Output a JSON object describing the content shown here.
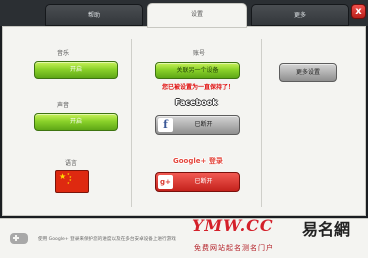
{
  "tabs": [
    {
      "label": "帮助"
    },
    {
      "label": "设置"
    },
    {
      "label": "更多"
    }
  ],
  "close_label": "x",
  "left_column": {
    "music_label": "音乐",
    "music_button": "开启",
    "sound_label": "声音",
    "sound_button": "开启",
    "language_label": "语言"
  },
  "middle_column": {
    "account_label": "账号",
    "account_button": "关联另一个设备",
    "warning_text": "您已被设置为一直保持了！",
    "facebook_title": "Facebook",
    "facebook_button": "已断开",
    "google_title": "Google+ 登录",
    "google_button": "已断开"
  },
  "right_column": {
    "more_button": "更多设置"
  },
  "bottom_bar": {
    "text": "使用 Google+ 登录来保护您的进度以及在多台安卓设备上进行游戏"
  },
  "watermark": {
    "url": "YMW.CC",
    "brand": "易名網",
    "slogan": "免费网站起名测名门户"
  },
  "colors": {
    "green_button": "#8bd22a",
    "grey_button": "#b0b0b0",
    "red_button": "#d9302a",
    "warning": "#e10f0f"
  }
}
